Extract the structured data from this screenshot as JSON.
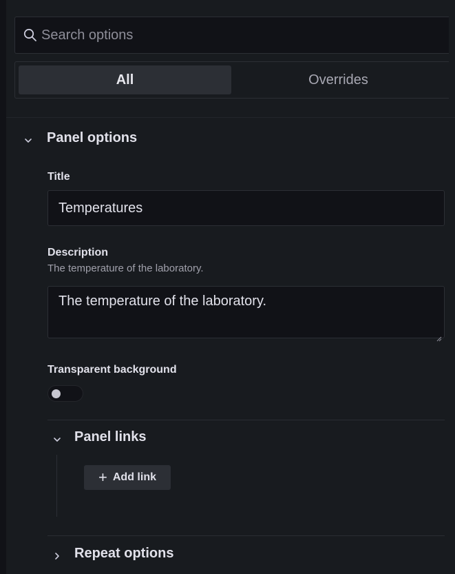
{
  "search": {
    "placeholder": "Search options"
  },
  "tabs": [
    {
      "label": "All",
      "active": true
    },
    {
      "label": "Overrides",
      "active": false
    }
  ],
  "panel_options": {
    "header": "Panel options",
    "expanded": true,
    "title": {
      "label": "Title",
      "value": "Temperatures"
    },
    "description": {
      "label": "Description",
      "help": "The temperature of the laboratory.",
      "value": "The temperature of the laboratory."
    },
    "transparent_background": {
      "label": "Transparent background",
      "enabled": false
    },
    "panel_links": {
      "header": "Panel links",
      "expanded": true,
      "add_link_label": "Add link"
    },
    "repeat_options": {
      "header": "Repeat options",
      "expanded": false
    }
  },
  "colors": {
    "background": "#181b1f",
    "input_background": "#111217",
    "border": "#2c2f35",
    "text": "#e1e1ea",
    "muted_text": "#a0a0ab"
  }
}
